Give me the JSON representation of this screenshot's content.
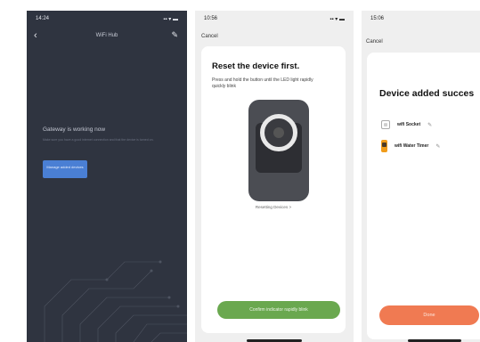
{
  "phone1": {
    "status_time": "14:24",
    "status_icons": "▪▪ ▾ ▬",
    "title": "WiFi Hub",
    "message": "Gateway is working now",
    "subtext": "Make sure you have a good internet connection and that the device is turned on.",
    "button_label": "Manage added devices"
  },
  "phone2": {
    "status_time": "10:56",
    "status_icons": "▪▪ ▾ ▬",
    "cancel": "Cancel",
    "title": "Reset the device first.",
    "desc": "Press and hold the button until the LED light rapidly quickly blink",
    "resetting": "Resetting Devices >",
    "confirm": "Confirm indicator rapidly blink"
  },
  "phone3": {
    "status_time": "15:06",
    "cancel": "Cancel",
    "title": "Device added succes",
    "devices": [
      {
        "name": "wifi Socket",
        "icon": "socket-icon"
      },
      {
        "name": "wifi Water Timer",
        "icon": "water-timer-icon"
      }
    ],
    "done": "Done"
  },
  "colors": {
    "dark_bg": "#2f3440",
    "blue_button": "#4a7fd4",
    "green_button": "#6aa84f",
    "orange_button": "#f07a52"
  }
}
